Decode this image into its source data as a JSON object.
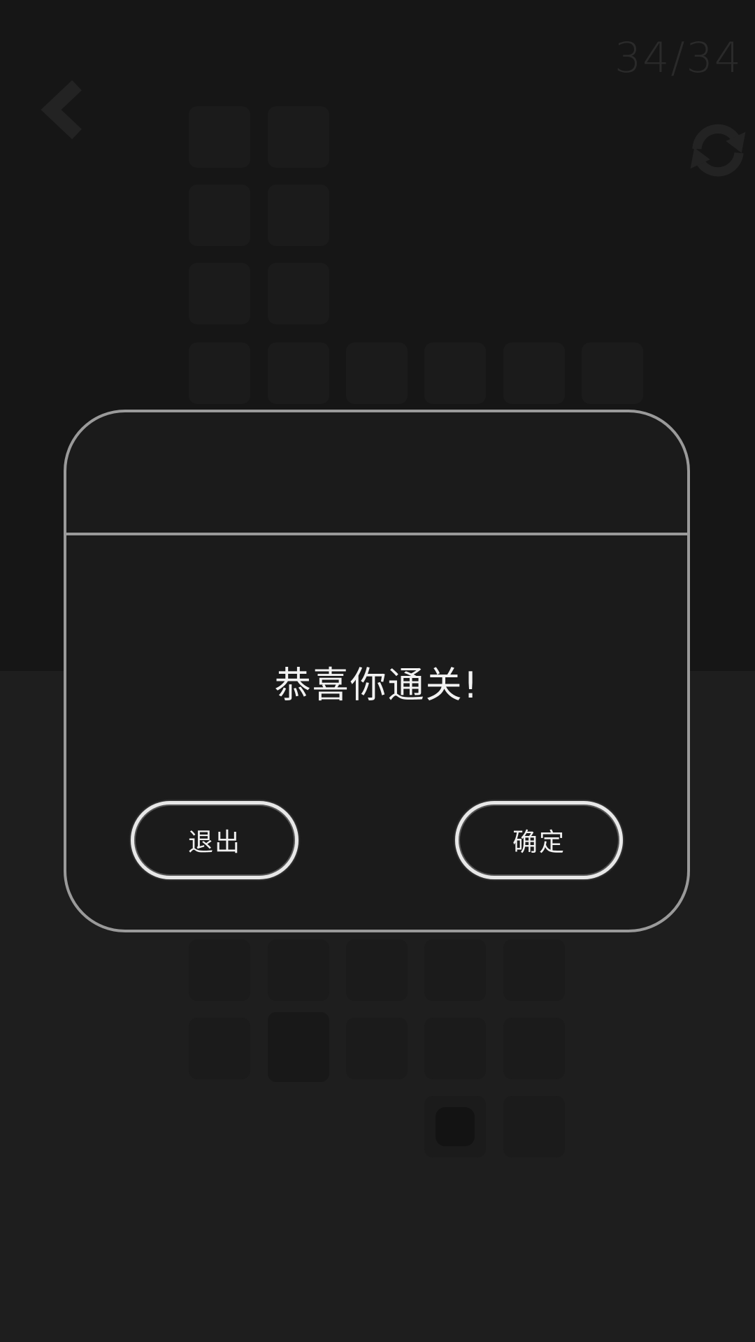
{
  "header": {
    "level_counter": "34/34",
    "back_icon": "chevron-left-icon",
    "refresh_icon": "refresh-icon"
  },
  "dialog": {
    "message": "恭喜你通关!",
    "exit_label": "退出",
    "confirm_label": "确定"
  },
  "colors": {
    "top_background": "#161616",
    "bottom_background": "#1e1e1e",
    "dialog_border": "#9a9a9a",
    "text": "#f2f2f2"
  }
}
